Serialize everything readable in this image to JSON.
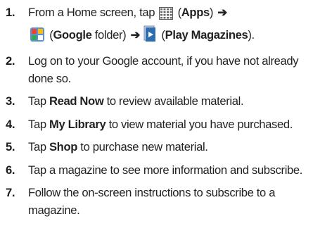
{
  "steps": [
    {
      "num": "1.",
      "parts": {
        "t1": "From a Home screen, tap ",
        "t2": " (",
        "apps": "Apps",
        "t3": ") ",
        "arrow1": "➔",
        "t4": " (",
        "google": "Google",
        "t5": " folder) ",
        "arrow2": "➔",
        "t6": " (",
        "play": "Play Magazines",
        "t7": ")."
      },
      "icons": [
        "apps-grid-icon",
        "google-folder-icon",
        "play-magazines-icon"
      ]
    },
    {
      "num": "2.",
      "text": "Log on to your Google account, if you have not already done so."
    },
    {
      "num": "3.",
      "pre": "Tap ",
      "bold": "Read Now",
      "post": " to review available material."
    },
    {
      "num": "4.",
      "pre": "Tap ",
      "bold": "My Library",
      "post": " to view material you have purchased."
    },
    {
      "num": "5.",
      "pre": "Tap ",
      "bold": "Shop",
      "post": " to purchase new material."
    },
    {
      "num": "6.",
      "text": "Tap a magazine to see more information and subscribe."
    },
    {
      "num": "7.",
      "text": "Follow the on-screen instructions to subscribe to a magazine."
    }
  ],
  "colors": {
    "text": "#222222",
    "google_icon_bg": "#5b8fd6",
    "magazine_icon": "#2f6db3"
  }
}
